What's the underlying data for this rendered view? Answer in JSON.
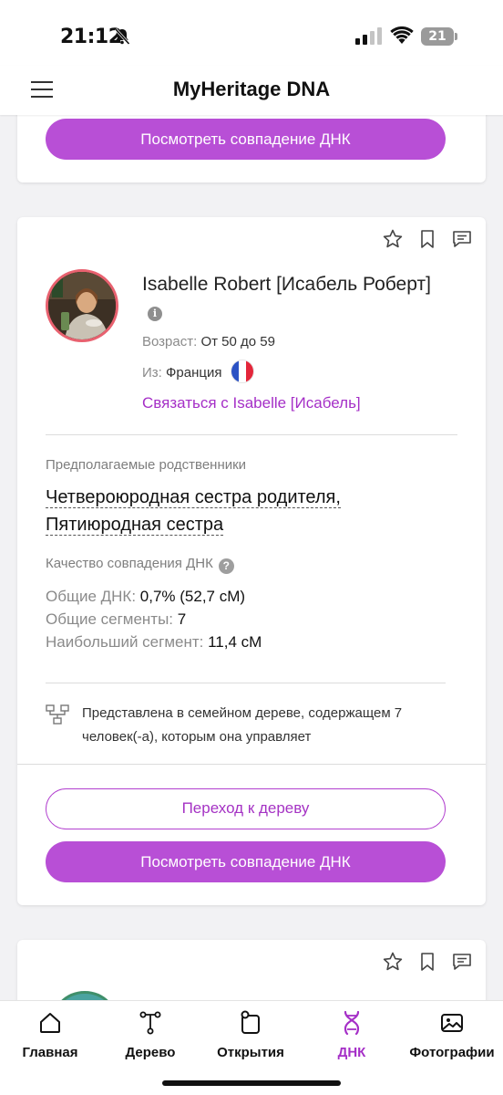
{
  "status": {
    "time": "21:12",
    "battery": "21"
  },
  "header": {
    "title": "MyHeritage DNA"
  },
  "top_card": {
    "view_match_label": "Посмотреть совпадение ДНК"
  },
  "match": {
    "name": "Isabelle Robert [Исабель Роберт]",
    "age_label": "Возраст:",
    "age_value": "От 50 до 59",
    "from_label": "Из:",
    "from_value": "Франция",
    "contact_label": "Связаться с Isabelle [Исабель]",
    "relatives_label": "Предполагаемые родственники",
    "relatives_line1": "Четвероюродная сестра родителя,",
    "relatives_line2": "Пятиюродная сестра",
    "quality_label": "Качество совпадения ДНК",
    "shared_dna_label": "Общие ДНК:",
    "shared_dna_value": "0,7% (52,7 сМ)",
    "shared_segments_label": "Общие сегменты:",
    "shared_segments_value": "7",
    "largest_segment_label": "Наибольший сегмент:",
    "largest_segment_value": "11,4 сМ",
    "tree_note": "Представлена в семейном дереве, содержащем 7 человек(-а), которым она управляет",
    "go_to_tree_label": "Переход к дереву",
    "view_match_label": "Посмотреть совпадение ДНК"
  },
  "bottom_nav": {
    "items": [
      {
        "label": "Главная",
        "icon": "home-icon"
      },
      {
        "label": "Дерево",
        "icon": "tree-icon"
      },
      {
        "label": "Открытия",
        "icon": "discoveries-icon"
      },
      {
        "label": "ДНК",
        "icon": "dna-icon",
        "active": true
      },
      {
        "label": "Фотографии",
        "icon": "photos-icon"
      }
    ]
  },
  "colors": {
    "accent": "#b84fd6",
    "link": "#a52fc7",
    "avatar_ring": "#e8616f"
  }
}
